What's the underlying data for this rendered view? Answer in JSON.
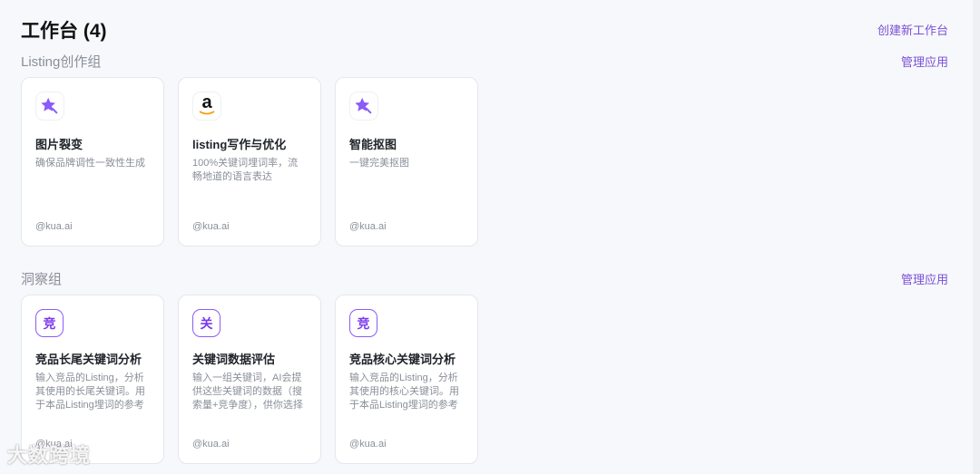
{
  "header": {
    "title": "工作台 (4)",
    "create_label": "创建新工作台"
  },
  "groups": [
    {
      "name": "Listing创作组",
      "manage_label": "管理应用",
      "cards": [
        {
          "icon": "magic-star-icon",
          "title": "图片裂变",
          "desc": "确保品牌调性一致性生成",
          "author": "@kua.ai"
        },
        {
          "icon": "amazon-icon",
          "icon_text": "a",
          "title": "listing写作与优化",
          "desc": "100%关键词埋词率，流畅地道的语言表达",
          "author": "@kua.ai"
        },
        {
          "icon": "magic-star-icon",
          "title": "智能抠图",
          "desc": "一键完美抠图",
          "author": "@kua.ai"
        }
      ]
    },
    {
      "name": "洞察组",
      "manage_label": "管理应用",
      "cards": [
        {
          "icon": "char-icon",
          "icon_text": "竞",
          "title": "竞品长尾关键词分析",
          "desc": "输入竞品的Listing，分析其使用的长尾关键词。用于本品Listing埋词的参考",
          "author": "@kua.ai"
        },
        {
          "icon": "char-icon",
          "icon_text": "关",
          "title": "关键词数据评估",
          "desc": "输入一组关键词，AI会提供这些关键词的数据（搜索量+竞争度），供你选择",
          "author": "@kua.ai"
        },
        {
          "icon": "char-icon",
          "icon_text": "竞",
          "title": "竞品核心关键词分析",
          "desc": "输入竞品的Listing，分析其使用的核心关键词。用于本品Listing埋词的参考",
          "author": "@kua.ai"
        }
      ]
    }
  ],
  "watermark": "大数跨境",
  "colors": {
    "accent": "#7b4fd6",
    "star": "#8b5cf6",
    "amazon_arrow": "#f59e0b"
  }
}
